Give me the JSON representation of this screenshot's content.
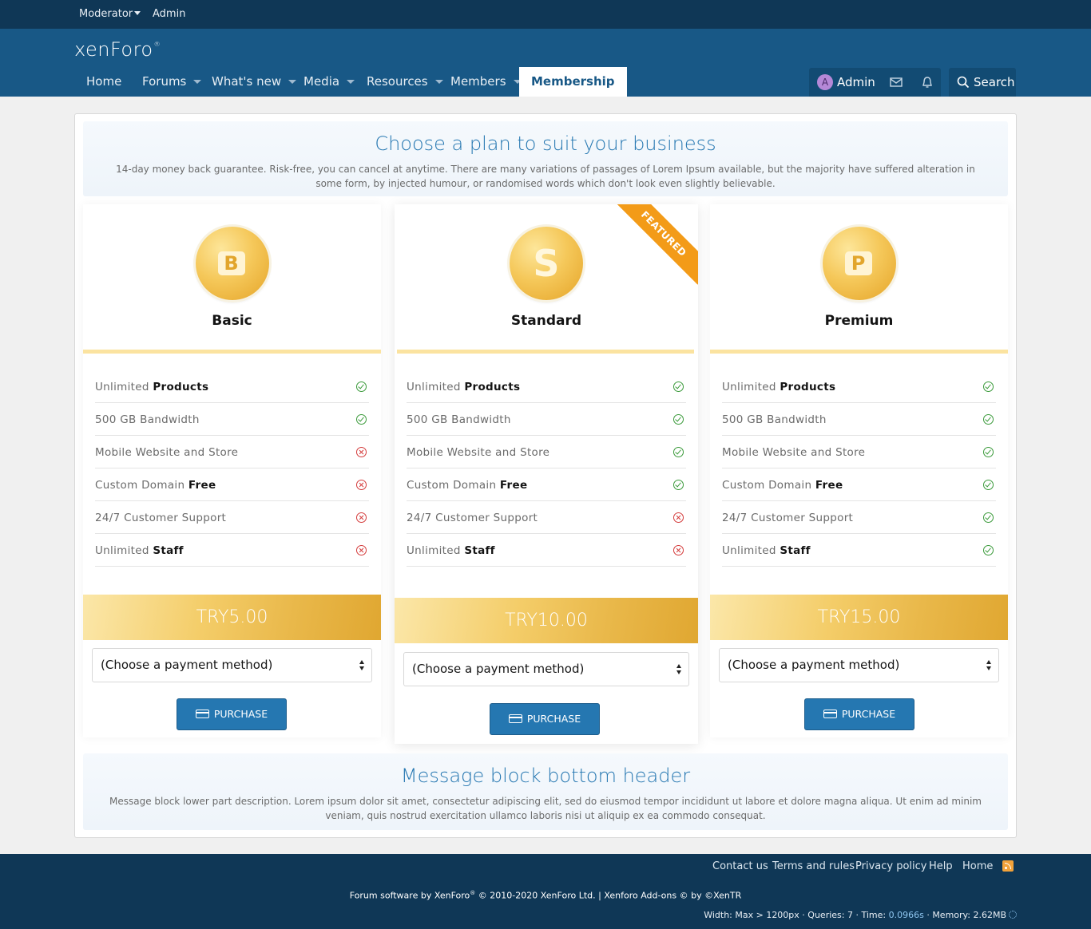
{
  "staff_bar": {
    "moderator": "Moderator",
    "admin": "Admin"
  },
  "logo": {
    "text": "xenForo",
    "mark": "®"
  },
  "nav": {
    "home": "Home",
    "forums": "Forums",
    "whats_new": "What's new",
    "media": "Media",
    "resources": "Resources",
    "members": "Members",
    "membership": "Membership",
    "user_initial": "A",
    "user_name": "Admin",
    "search": "Search"
  },
  "header_block": {
    "title": "Choose a plan to suit your business",
    "description": "14-day money back guarantee. Risk-free, you can cancel at anytime. There are many variations of passages of Lorem Ipsum available, but the majority have suffered alteration in some form, by injected humour, or randomised words which don't look even slightly believable."
  },
  "plans": [
    {
      "letter": "B",
      "name": "Basic",
      "features": [
        {
          "text": "Unlimited ",
          "bold": "Products",
          "ok": true
        },
        {
          "text": "500 GB Bandwidth",
          "bold": "",
          "ok": true
        },
        {
          "text": "Mobile Website and Store",
          "bold": "",
          "ok": false
        },
        {
          "text": "Custom Domain ",
          "bold": "Free",
          "ok": false
        },
        {
          "text": "24/7 Customer Support",
          "bold": "",
          "ok": false
        },
        {
          "text": "Unlimited ",
          "bold": "Staff",
          "ok": false
        }
      ],
      "price": "TRY5.00",
      "select": "(Choose a payment method)",
      "button": "PURCHASE"
    },
    {
      "letter": "S",
      "name": "Standard",
      "ribbon": "FEATURED",
      "features": [
        {
          "text": "Unlimited ",
          "bold": "Products",
          "ok": true
        },
        {
          "text": "500 GB Bandwidth",
          "bold": "",
          "ok": true
        },
        {
          "text": "Mobile Website and Store",
          "bold": "",
          "ok": true
        },
        {
          "text": "Custom Domain ",
          "bold": "Free",
          "ok": true
        },
        {
          "text": "24/7 Customer Support",
          "bold": "",
          "ok": false
        },
        {
          "text": "Unlimited ",
          "bold": "Staff",
          "ok": false
        }
      ],
      "price": "TRY10.00",
      "select": "(Choose a payment method)",
      "button": "PURCHASE"
    },
    {
      "letter": "P",
      "name": "Premium",
      "features": [
        {
          "text": "Unlimited ",
          "bold": "Products",
          "ok": true
        },
        {
          "text": "500 GB Bandwidth",
          "bold": "",
          "ok": true
        },
        {
          "text": "Mobile Website and Store",
          "bold": "",
          "ok": true
        },
        {
          "text": "Custom Domain ",
          "bold": "Free",
          "ok": true
        },
        {
          "text": "24/7 Customer Support",
          "bold": "",
          "ok": true
        },
        {
          "text": "Unlimited ",
          "bold": "Staff",
          "ok": true
        }
      ],
      "price": "TRY15.00",
      "select": "(Choose a payment method)",
      "button": "PURCHASE"
    }
  ],
  "footer_block": {
    "title": "Message block bottom header",
    "description": "Message block lower part description. Lorem ipsum dolor sit amet, consectetur adipiscing elit, sed do eiusmod tempor incididunt ut labore et dolore magna aliqua. Ut enim ad minim veniam, quis nostrud exercitation ullamco laboris nisi ut aliquip ex ea commodo consequat."
  },
  "footer": {
    "contact": "Contact us",
    "terms": "Terms and rules",
    "privacy": "Privacy policy",
    "help": "Help",
    "home": "Home",
    "copyright_a": "Forum software by XenForo",
    "copyright_reg": "®",
    "copyright_b": " © 2010-2020 XenForo Ltd. | Xenforo Add-ons © by ©XenTR",
    "debug_a": "Width: Max > 1200px · Queries: 7 · Time: ",
    "debug_time": "0.0966s",
    "debug_b": " · Memory: 2.62MB"
  },
  "colors": {
    "header": "#185886",
    "staff_bar": "#0f3756",
    "accent": "#2577b1",
    "gold": "#f4cd69",
    "ribbon": "#f39b18",
    "ok": "#3a9a3a",
    "no": "#d43b3b"
  }
}
